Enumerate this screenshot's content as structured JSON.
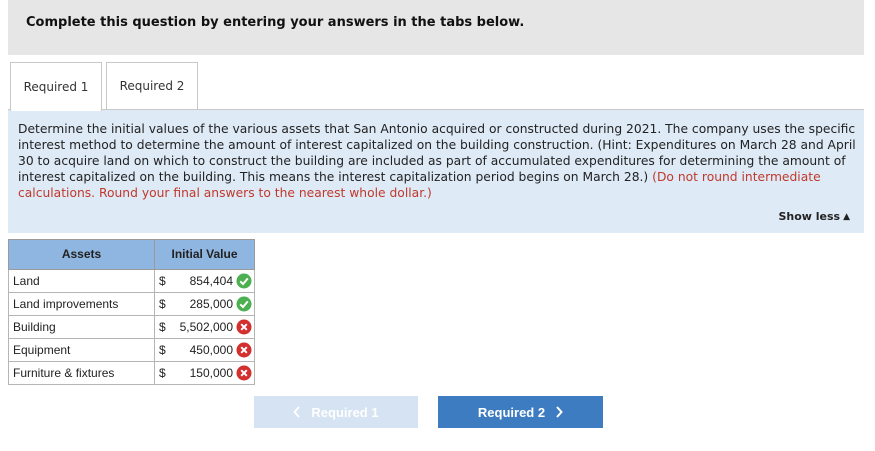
{
  "banner": {
    "text": "Complete this question by entering your answers in the tabs below."
  },
  "tabs": [
    {
      "label": "Required 1",
      "active": true
    },
    {
      "label": "Required 2",
      "active": false
    }
  ],
  "instructions": {
    "body": "Determine the initial values of the various assets that San Antonio acquired or constructed during 2021. The company uses the specific interest method to determine the amount of interest capitalized on the building construction. (Hint: Expenditures on March 28 and April 30 to acquire land on which to construct the building are included as part of accumulated expenditures for determining the amount of interest capitalized on the building. This means the interest capitalization period begins on March 28.)",
    "note": "(Do not round intermediate calculations. Round your final answers to the nearest whole dollar.)"
  },
  "show_less": {
    "label": "Show less",
    "icon": "up-triangle-icon"
  },
  "table": {
    "headers": {
      "assets": "Assets",
      "initial_value": "Initial Value"
    },
    "rows": [
      {
        "asset": "Land",
        "currency": "$",
        "value": "854,404",
        "status": "correct"
      },
      {
        "asset": "Land improvements",
        "currency": "$",
        "value": "285,000",
        "status": "correct"
      },
      {
        "asset": "Building",
        "currency": "$",
        "value": "5,502,000",
        "status": "incorrect"
      },
      {
        "asset": "Equipment",
        "currency": "$",
        "value": "450,000",
        "status": "incorrect"
      },
      {
        "asset": "Furniture & fixtures",
        "currency": "$",
        "value": "150,000",
        "status": "incorrect"
      }
    ]
  },
  "nav": {
    "prev_label": "Required 1",
    "next_label": "Required 2",
    "prev_icon": "chevron-left-icon",
    "next_icon": "chevron-right-icon"
  },
  "colors": {
    "correct": "#4caf50",
    "incorrect": "#d32f2f",
    "header_blue": "#8fb6e0",
    "panel_blue": "#dfeaf7",
    "button_blue": "#3d7cc0"
  }
}
